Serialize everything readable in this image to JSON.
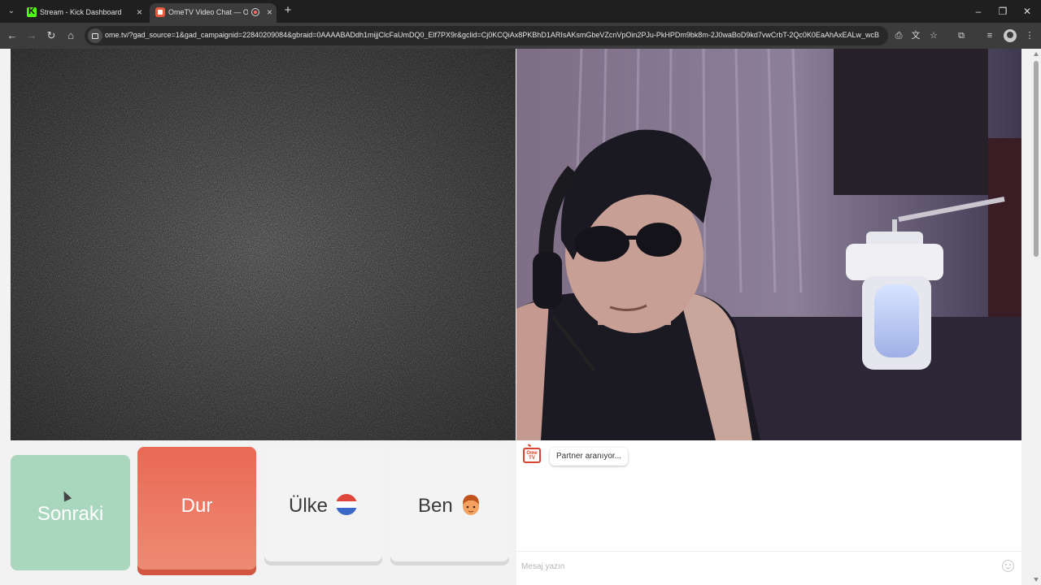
{
  "browser": {
    "tabs": [
      {
        "title": "Stream - Kick Dashboard",
        "active": false,
        "favicon": "kick-icon"
      },
      {
        "title": "OmeTV Video Chat — Ome",
        "active": true,
        "favicon": "ometv-icon",
        "recording": true
      }
    ],
    "url": "ome.tv/?gad_source=1&gad_campaignid=22840209084&gbraid=0AAAABADdh1mijjClcFaUmDQ0_Elf7PX9r&gclid=Cj0KCQiAx8PKBhD1ARIsAKsmGbeVZcnVpOin2PJu-PkHPDm9bk8m-2J0waBoD9kd7vwCrbT-2Qc0K0EaAhAxEALw_wcB"
  },
  "controls": {
    "next_label": "Sonraki",
    "stop_label": "Dur",
    "country_label": "Ülke",
    "gender_label": "Ben"
  },
  "chat": {
    "logo_text": "Ome TV",
    "status": "Partner aranıyor...",
    "input_placeholder": "Mesaj yazın"
  },
  "colors": {
    "next_button": "#a9d7bd",
    "stop_button": "#e96954",
    "brand": "#d9452e"
  }
}
